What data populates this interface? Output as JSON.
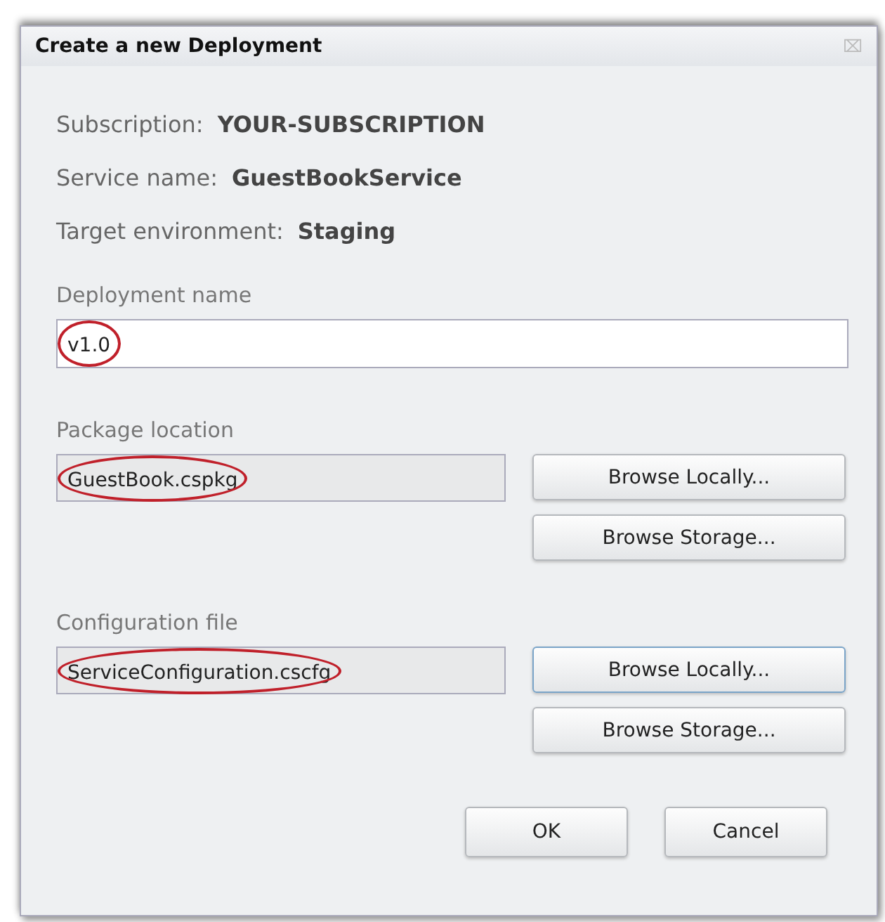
{
  "window": {
    "title": "Create a new Deployment",
    "close": "⌧"
  },
  "info": [
    {
      "label": "Subscription:",
      "value": "YOUR-SUBSCRIPTION"
    },
    {
      "label": "Service name:",
      "value": "GuestBookService"
    },
    {
      "label": "Target environment:",
      "value": "Staging"
    }
  ],
  "fields": [
    {
      "kind": "text",
      "label": "Deployment name",
      "value": "v1.0",
      "highlighted": true
    },
    {
      "kind": "file",
      "label": "Package location",
      "value": "GuestBook.cspkg",
      "highlighted": true,
      "buttons": [
        {
          "label": "Browse Locally...",
          "focused": false
        },
        {
          "label": "Browse Storage...",
          "focused": false
        }
      ]
    },
    {
      "kind": "file",
      "label": "Configuration file",
      "value": "ServiceConfiguration.cscfg",
      "highlighted": true,
      "buttons": [
        {
          "label": "Browse Locally...",
          "focused": true
        },
        {
          "label": "Browse Storage...",
          "focused": false
        }
      ]
    }
  ],
  "buttons": [
    "OK",
    "Cancel"
  ]
}
